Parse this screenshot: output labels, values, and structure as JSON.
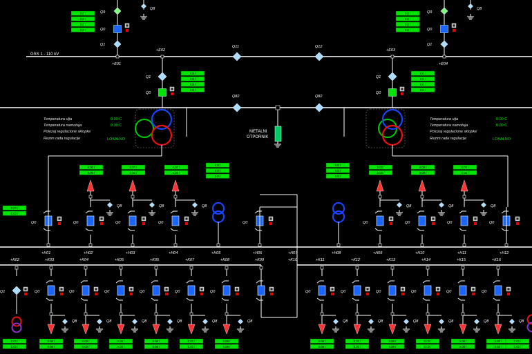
{
  "substation": {
    "main_bus_label": "GSS 1 - 110 kV",
    "isolators_top": [
      "Q11",
      "Q12"
    ],
    "isolators_mid": [
      "Q82",
      "Q82"
    ],
    "resistor_label": [
      "METALNI",
      "OTPORNIK"
    ],
    "resistor_bay": "+H07",
    "resistor_bay2": "+K10",
    "earth_label": "Q8",
    "default_value": "0.00 /",
    "zero_value": "0.0 /",
    "transformers": [
      {
        "id": "left",
        "temp_oil_label": "Temperatura ulja",
        "temp_wind_label": "Temperatura namotaja",
        "tap_label": "Polozaj regulacione sklopke",
        "mode_label": "Rezim rada regulacije",
        "temp_oil": "0.00 C",
        "temp_wind": "0.00 C",
        "tap": "",
        "mode": "LOKALNO"
      },
      {
        "id": "right",
        "temp_oil_label": "Temperatura ulja",
        "temp_wind_label": "Temperatura namotaja",
        "tap_label": "Polozaj regulacione sklopke",
        "mode_label": "Rezim rada regulacije",
        "temp_oil": "0.00 C",
        "temp_wind": "0.00 C",
        "tap": "",
        "mode": "LOKALNO"
      }
    ],
    "feeders_top": [
      {
        "bay": "+E01",
        "q9": "Q9",
        "q0": "Q0",
        "q1": "Q1",
        "q8": "Q8",
        "values": [
          "0.0 /",
          "0.0 /",
          "0.0 /",
          "0.0 /"
        ]
      },
      {
        "bay": "+E02",
        "q1": "Q1",
        "q0": "Q0",
        "values": [
          "0.0 /",
          "0.0 /",
          "0.0 /",
          "0.0 /"
        ]
      },
      {
        "bay": "+E03",
        "q1": "Q1",
        "q0": "Q0",
        "values": [
          "0.0 /",
          "0.0 /",
          "0.0 /",
          "0.0 /"
        ]
      },
      {
        "bay": "+E04",
        "q9": "Q9",
        "q0": "Q0",
        "q1": "Q1",
        "q8": "Q8",
        "values": [
          "0.0 /",
          "0.0 /",
          "0.0 /",
          "0.0 /"
        ]
      }
    ],
    "bays_h": [
      "+H01",
      "+H02",
      "+H03",
      "+H04",
      "+H05",
      "+H06",
      "+H08",
      "+H09",
      "+H10",
      "+H11",
      "+H12"
    ],
    "bays_k": [
      "+K02",
      "+K03",
      "+K04",
      "+K05",
      "+K05",
      "+K07",
      "+K08",
      "+K09",
      "+K11",
      "+K12",
      "+K13",
      "+K14",
      "+K15",
      "+K16"
    ],
    "sw_labels": {
      "q0": "Q0",
      "q8": "Q8",
      "q1": "Q1"
    }
  }
}
